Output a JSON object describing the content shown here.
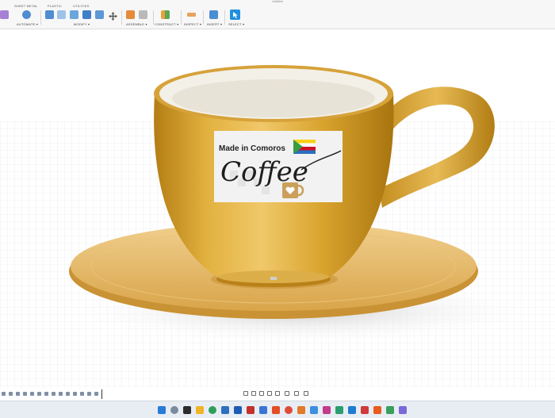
{
  "window": {
    "title": "Untitled"
  },
  "tabs": [
    "SHEET METAL",
    "PLASTIC",
    "UTILITIES"
  ],
  "toolbar_groups": [
    "AUTOMATE ▾",
    "MODIFY ▾",
    "ASSEMBLE ▾",
    "CONSTRUCT ▾",
    "INSPECT ▾",
    "INSERT ▾",
    "SELECT ▾"
  ],
  "decal": {
    "line1": "Made in Comoros",
    "line2": "Coffee"
  },
  "colors": {
    "cup_body": "#d9a42e",
    "cup_shadow": "#b47d14",
    "saucer": "#e3b768",
    "grid": "#dfe3ea",
    "accent_select": "#1f8fe0"
  },
  "icons": {
    "toolbar": [
      "sheet-icon",
      "automate-icon",
      "modify-press-pull-icon",
      "modify-fillet-icon",
      "modify-shell-icon",
      "modify-combine-icon",
      "move-icon",
      "assemble-joint-icon",
      "assemble-as-built-icon",
      "construct-plane-icon",
      "inspect-measure-icon",
      "insert-image-icon",
      "select-cursor-icon"
    ],
    "taskbar": [
      "windows-start-icon",
      "search-icon",
      "file-explorer-icon",
      "edge-icon",
      "chrome-icon",
      "store-icon",
      "office-icon",
      "vscode-icon",
      "settings-icon"
    ]
  }
}
